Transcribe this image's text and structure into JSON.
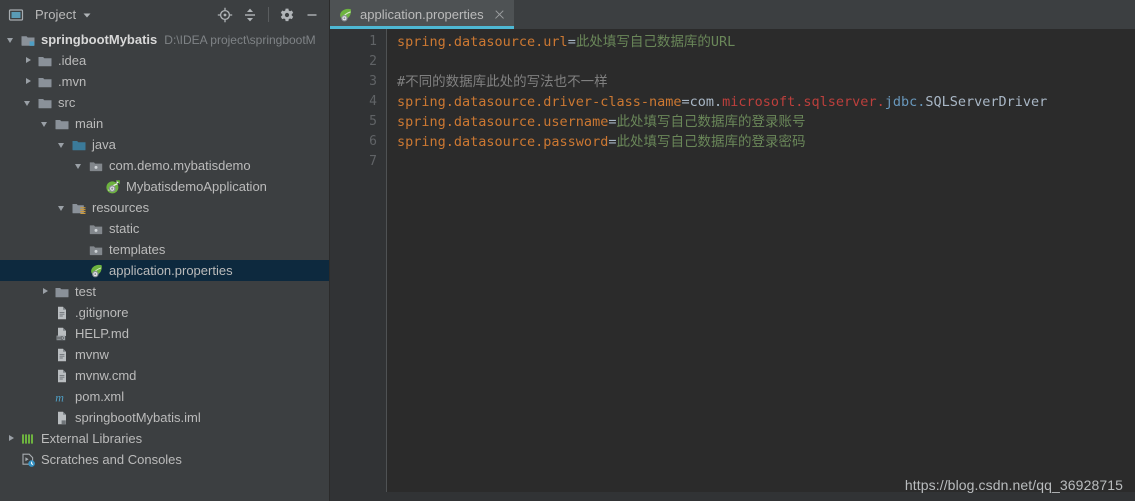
{
  "sidebar": {
    "header": {
      "title": "Project",
      "dropdown_icon": "chevron-down-icon",
      "window_icon": "project-window-icon",
      "actions": [
        {
          "name": "locate-icon",
          "tooltip": "Select Opened File"
        },
        {
          "name": "collapse-all-icon",
          "tooltip": "Collapse All"
        },
        {
          "name": "gear-icon",
          "tooltip": "Settings"
        },
        {
          "name": "minimize-icon",
          "tooltip": "Hide"
        }
      ]
    },
    "tree": [
      {
        "label": "springbootMybatis",
        "sub": "D:\\IDEA project\\springbootM",
        "depth": 0,
        "arrow": "down",
        "icon": "module-icon",
        "bold": true,
        "selected": false
      },
      {
        "label": ".idea",
        "sub": "",
        "depth": 1,
        "arrow": "right",
        "icon": "folder-icon",
        "bold": false,
        "selected": false
      },
      {
        "label": ".mvn",
        "sub": "",
        "depth": 1,
        "arrow": "right",
        "icon": "folder-icon",
        "bold": false,
        "selected": false
      },
      {
        "label": "src",
        "sub": "",
        "depth": 1,
        "arrow": "down",
        "icon": "folder-icon",
        "bold": false,
        "selected": false
      },
      {
        "label": "main",
        "sub": "",
        "depth": 2,
        "arrow": "down",
        "icon": "folder-icon",
        "bold": false,
        "selected": false
      },
      {
        "label": "java",
        "sub": "",
        "depth": 3,
        "arrow": "down",
        "icon": "source-folder-icon",
        "bold": false,
        "selected": false
      },
      {
        "label": "com.demo.mybatisdemo",
        "sub": "",
        "depth": 4,
        "arrow": "down",
        "icon": "package-icon",
        "bold": false,
        "selected": false
      },
      {
        "label": "MybatisdemoApplication",
        "sub": "",
        "depth": 5,
        "arrow": "none",
        "icon": "spring-boot-class-icon",
        "bold": false,
        "selected": false
      },
      {
        "label": "resources",
        "sub": "",
        "depth": 3,
        "arrow": "down",
        "icon": "resources-folder-icon",
        "bold": false,
        "selected": false
      },
      {
        "label": "static",
        "sub": "",
        "depth": 4,
        "arrow": "none",
        "icon": "package-icon",
        "bold": false,
        "selected": false
      },
      {
        "label": "templates",
        "sub": "",
        "depth": 4,
        "arrow": "none",
        "icon": "package-icon",
        "bold": false,
        "selected": false
      },
      {
        "label": "application.properties",
        "sub": "",
        "depth": 4,
        "arrow": "none",
        "icon": "spring-file-icon",
        "bold": false,
        "selected": true
      },
      {
        "label": "test",
        "sub": "",
        "depth": 2,
        "arrow": "right",
        "icon": "folder-icon",
        "bold": false,
        "selected": false
      },
      {
        "label": ".gitignore",
        "sub": "",
        "depth": 2,
        "arrow": "none",
        "icon": "file-icon",
        "bold": false,
        "selected": false
      },
      {
        "label": "HELP.md",
        "sub": "",
        "depth": 2,
        "arrow": "none",
        "icon": "markdown-file-icon",
        "bold": false,
        "selected": false
      },
      {
        "label": "mvnw",
        "sub": "",
        "depth": 2,
        "arrow": "none",
        "icon": "file-icon",
        "bold": false,
        "selected": false
      },
      {
        "label": "mvnw.cmd",
        "sub": "",
        "depth": 2,
        "arrow": "none",
        "icon": "file-icon",
        "bold": false,
        "selected": false
      },
      {
        "label": "pom.xml",
        "sub": "",
        "depth": 2,
        "arrow": "none",
        "icon": "maven-file-icon",
        "bold": false,
        "selected": false
      },
      {
        "label": "springbootMybatis.iml",
        "sub": "",
        "depth": 2,
        "arrow": "none",
        "icon": "iml-file-icon",
        "bold": false,
        "selected": false
      },
      {
        "label": "External Libraries",
        "sub": "",
        "depth": 0,
        "arrow": "right",
        "icon": "libraries-icon",
        "bold": false,
        "selected": false
      },
      {
        "label": "Scratches and Consoles",
        "sub": "",
        "depth": 0,
        "arrow": "none",
        "icon": "scratches-icon",
        "bold": false,
        "selected": false
      }
    ]
  },
  "editor": {
    "tab": {
      "label": "application.properties",
      "icon": "spring-file-icon",
      "close_icon": "close-icon",
      "active_underline_color": "#4eb8d4"
    },
    "line_numbers": [
      "1",
      "2",
      "3",
      "4",
      "5",
      "6",
      "7"
    ],
    "lines": [
      {
        "n": 1,
        "type": "prop",
        "key": "spring.datasource.url",
        "value": "此处填写自己数据库的URL"
      },
      {
        "n": 2,
        "type": "blank"
      },
      {
        "n": 3,
        "type": "comment",
        "text": "#不同的数据库此处的写法也不一样"
      },
      {
        "n": 4,
        "type": "prop-class",
        "key": "spring.datasource.driver-class-name",
        "segments": [
          {
            "text": "com.",
            "color": "cls"
          },
          {
            "text": "microsoft.sqlserver.",
            "color": "red"
          },
          {
            "text": "jdbc.",
            "color": "blu"
          },
          {
            "text": "SQLServerDriver",
            "color": "cls"
          }
        ]
      },
      {
        "n": 5,
        "type": "prop",
        "key": "spring.datasource.username",
        "value": "此处填写自己数据库的登录账号"
      },
      {
        "n": 6,
        "type": "prop",
        "key": "spring.datasource.password",
        "value": "此处填写自己数据库的登录密码"
      },
      {
        "n": 7,
        "type": "blank"
      }
    ]
  },
  "watermark": "https://blog.csdn.net/qq_36928715",
  "colors": {
    "sidebar_bg": "#3c3f41",
    "editor_bg": "#2b2b2b",
    "gutter_bg": "#313335",
    "selection_bg": "#0d293e",
    "key_color": "#cc7832",
    "value_color": "#6a8759",
    "comment_color": "#808080",
    "accent": "#4eb8d4"
  }
}
